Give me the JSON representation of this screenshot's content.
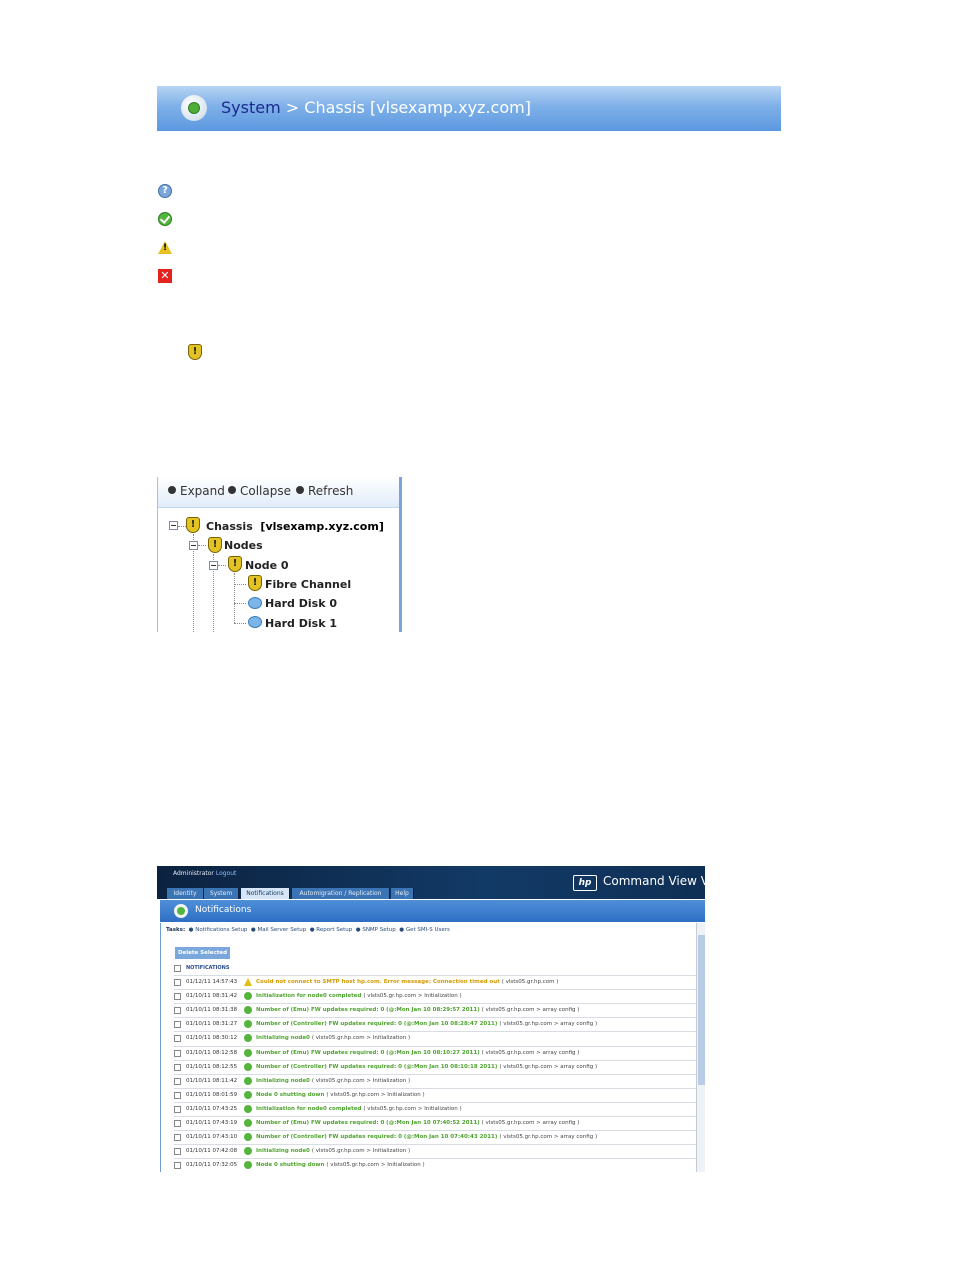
{
  "banner": {
    "crumb_system": "System",
    "separator": ">",
    "crumb_chassis": "Chassis",
    "host": "[vlsexamp.xyz.com]"
  },
  "legend_icons": [
    "question-icon",
    "ok-icon",
    "warning-icon",
    "error-icon"
  ],
  "tree": {
    "toolbar": {
      "expand": "Expand",
      "collapse": "Collapse",
      "refresh": "Refresh"
    },
    "chassis_label": "Chassis",
    "chassis_host": "[vlsexamp.xyz.com]",
    "nodes_label": "Nodes",
    "node0_label": "Node 0",
    "fibre_label": "Fibre Channel",
    "disk0_label": "Hard Disk 0",
    "disk1_label": "Hard Disk 1"
  },
  "commandview": {
    "admin_label": "Administrator",
    "logout_label": "Logout",
    "logo": "hp",
    "product": "Command View VLS",
    "tabs": [
      "Identity",
      "System",
      "Notifications",
      "Automigration / Replication",
      "Help"
    ],
    "title": "Notifications",
    "tasks_label": "Tasks:",
    "tasks": [
      "Notifications Setup",
      "Mail Server Setup",
      "Report Setup",
      "SNMP Setup",
      "Get SMI-S Users"
    ],
    "delete_button": "Delete Selected",
    "header": "NOTIFICATIONS",
    "rows": [
      {
        "ts": "01/12/11 14:57:43",
        "msg": "Could not connect to SMTP host hp.com. Error message: Connection timed out",
        "src": "( vlsts05.gr.hp.com )",
        "level": "warning"
      },
      {
        "ts": "01/10/11 08:31:42",
        "msg": "Initialization for node0 completed",
        "src": "( vlsts05.gr.hp.com  >  Initialization )",
        "level": "ok"
      },
      {
        "ts": "01/10/11 08:31:38",
        "msg": "Number of (Emu) FW updates required: 0 (@:Mon Jan 10 08:29:57 2011)",
        "src": "( vlsts05.gr.hp.com  >  array config )",
        "level": "ok"
      },
      {
        "ts": "01/10/11 08:31:27",
        "msg": "Number of (Controller) FW updates required: 0 (@:Mon Jan 10 08:28:47 2011)",
        "src": "( vlsts05.gr.hp.com  >  array config )",
        "level": "ok"
      },
      {
        "ts": "01/10/11 08:30:12",
        "msg": "Initializing node0",
        "src": "( vlsts05.gr.hp.com  >  Initialization )",
        "level": "ok"
      },
      {
        "ts": "01/10/11 08:12:58",
        "msg": "Number of (Emu) FW updates required: 0 (@:Mon Jan 10 08:10:27 2011)",
        "src": "( vlsts05.gr.hp.com  >  array config )",
        "level": "ok"
      },
      {
        "ts": "01/10/11 08:12:55",
        "msg": "Number of (Controller) FW updates required: 0 (@:Mon Jan 10 08:10:18 2011)",
        "src": "( vlsts05.gr.hp.com  >  array config )",
        "level": "ok"
      },
      {
        "ts": "01/10/11 08:11:42",
        "msg": "Initializing node0",
        "src": "( vlsts05.gr.hp.com  >  Initialization )",
        "level": "ok"
      },
      {
        "ts": "01/10/11 08:01:59",
        "msg": "Node 0 shutting down",
        "src": "( vlsts05.gr.hp.com  >  Initialization )",
        "level": "ok"
      },
      {
        "ts": "01/10/11 07:43:25",
        "msg": "Initialization for node0 completed",
        "src": "( vlsts05.gr.hp.com  >  Initialization )",
        "level": "ok"
      },
      {
        "ts": "01/10/11 07:43:19",
        "msg": "Number of (Emu) FW updates required: 0 (@:Mon Jan 10 07:40:52 2011)",
        "src": "( vlsts05.gr.hp.com  >  array config )",
        "level": "ok"
      },
      {
        "ts": "01/10/11 07:43:10",
        "msg": "Number of (Controller) FW updates required: 0 (@:Mon Jan 10 07:40:43 2011)",
        "src": "( vlsts05.gr.hp.com  >  array config )",
        "level": "ok"
      },
      {
        "ts": "01/10/11 07:42:08",
        "msg": "Initializing node0",
        "src": "( vlsts05.gr.hp.com  >  Initialization )",
        "level": "ok"
      },
      {
        "ts": "01/10/11 07:32:05",
        "msg": "Node 0 shutting down",
        "src": "( vlsts05.gr.hp.com  >  Initialization )",
        "level": "ok"
      }
    ]
  }
}
